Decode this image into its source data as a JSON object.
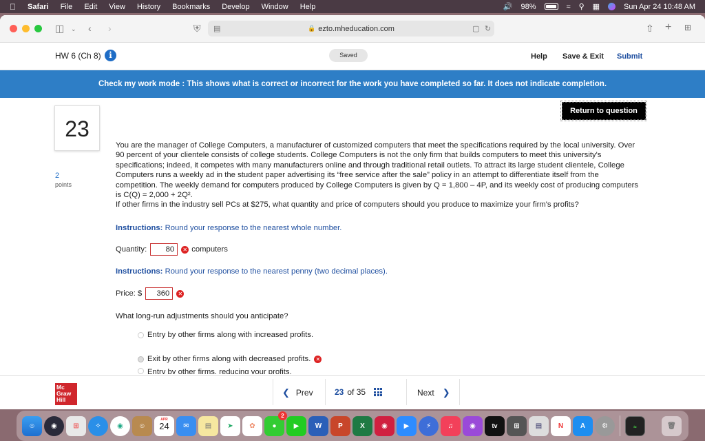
{
  "menubar": {
    "app": "Safari",
    "items": [
      "File",
      "Edit",
      "View",
      "History",
      "Bookmarks",
      "Develop",
      "Window",
      "Help"
    ],
    "battery": "98%",
    "datetime": "Sun Apr 24  10:48 AM"
  },
  "browser": {
    "url": "ezto.mheducation.com"
  },
  "header": {
    "title": "HW 6 (Ch 8)",
    "saved": "Saved",
    "help": "Help",
    "save_exit": "Save & Exit",
    "submit": "Submit"
  },
  "banner": "Check my work mode : This shows what is correct or incorrect for the work you have completed so far. It does not indicate completion.",
  "question": {
    "number": "23",
    "points": "2",
    "points_label": "points",
    "return_button": "Return to question",
    "text_main": "You are the manager of College Computers, a manufacturer of customized computers that meet the specifications required by the local university. Over 90 percent of your clientele consists of college students. College Computers is not the only firm that builds computers to meet this university's specifications; indeed, it competes with many manufacturers online and through traditional retail outlets. To attract its large student clientele, College Computers runs a weekly ad in the student paper advertising its “free service after the sale” policy in an attempt to differentiate itself from the competition. The weekly demand for computers produced by College Computers is given by Q = 1,800 – 4P, and its weekly cost of producing computers is C(Q) = 2,000 + 2Q².",
    "text_ask": "If other firms in the industry sell PCs at $275, what quantity and price of computers should you produce to maximize your firm's profits?",
    "instr_label": "Instructions:",
    "instr1": "Round your response to the nearest whole number.",
    "quantity_label": "Quantity:",
    "quantity_value": "80",
    "quantity_unit": "computers",
    "instr2": "Round your response to the nearest penny (two decimal places).",
    "price_label": "Price: $",
    "price_value": "360",
    "longrun_q": "What long-run adjustments should you anticipate?",
    "options": [
      "Entry by other firms along with increased profits.",
      "Exit by other firms along with decreased profits.",
      "Entry by other firms, reducing your profits."
    ],
    "selected_option": 1
  },
  "bottomnav": {
    "logo_lines": [
      "Mc",
      "Graw",
      "Hill"
    ],
    "prev": "Prev",
    "current": "23",
    "of": "of 35",
    "next": "Next"
  },
  "dock": {
    "calendar_month": "APR",
    "calendar_day": "24",
    "badge": "2"
  }
}
